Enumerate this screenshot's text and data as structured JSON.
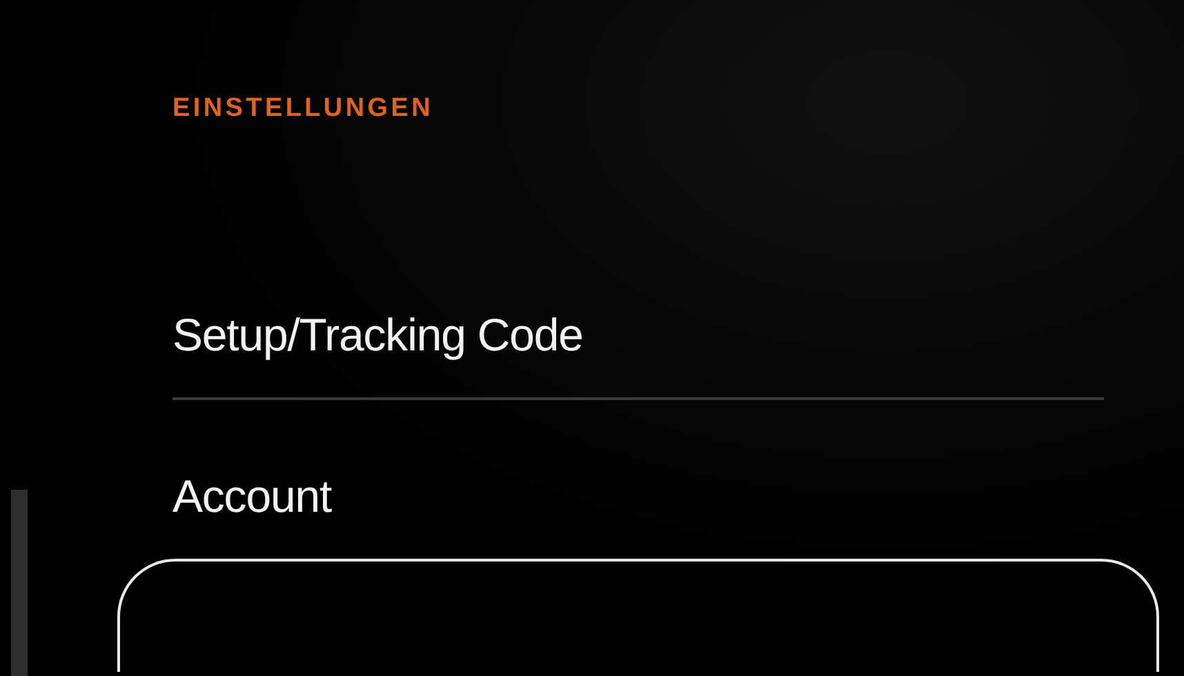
{
  "section_title": "EINSTELLUNGEN",
  "menu_items": [
    {
      "label": "Setup/Tracking Code"
    },
    {
      "label": "Account"
    }
  ]
}
